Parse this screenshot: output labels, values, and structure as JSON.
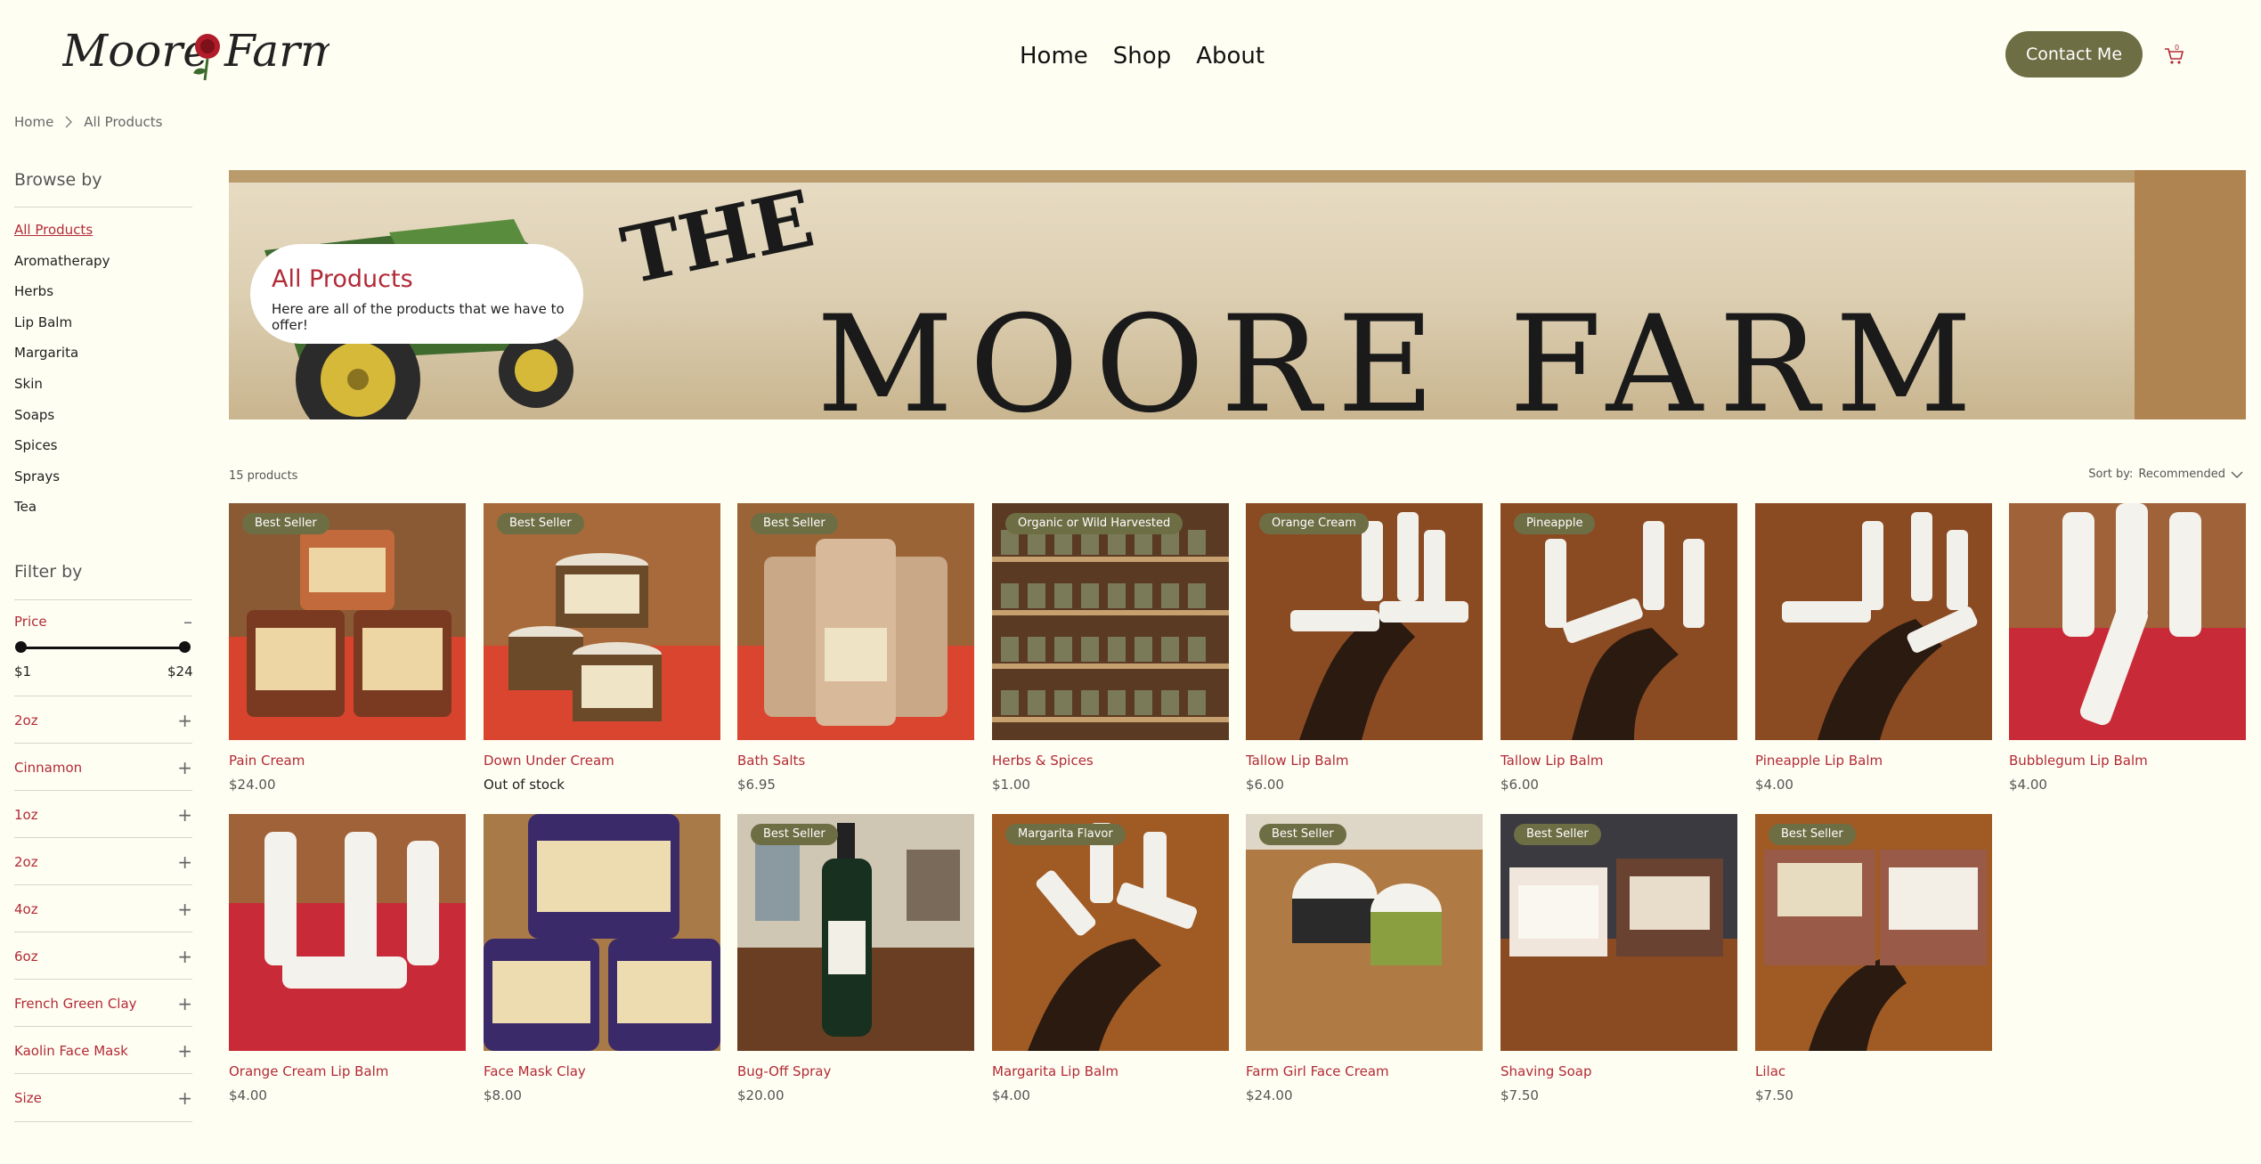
{
  "header": {
    "logo_text_left": "Moore",
    "logo_text_right": "Farm",
    "nav": [
      "Home",
      "Shop",
      "About"
    ],
    "contact_label": "Contact Me",
    "cart_count": "0"
  },
  "breadcrumb": [
    "Home",
    "All Products"
  ],
  "sidebar": {
    "browse_heading": "Browse by",
    "categories": [
      "All Products",
      "Aromatherapy",
      "Herbs",
      "Lip Balm",
      "Margarita",
      "Skin",
      "Soaps",
      "Spices",
      "Sprays",
      "Tea"
    ],
    "active_category": "All Products",
    "filter_heading": "Filter by",
    "price_label": "Price",
    "price_min": "$1",
    "price_max": "$24",
    "filters": [
      "2oz",
      "Cinnamon",
      "1oz",
      "2oz",
      "4oz",
      "6oz",
      "French Green Clay",
      "Kaolin Face Mask",
      "Size"
    ]
  },
  "banner": {
    "title": "All Products",
    "subtitle": "Here are all of the products that we have to offer!",
    "sign_text_1": "THE",
    "sign_text_2": "MOORE FARM"
  },
  "products_meta": {
    "count": "15 products",
    "sort_label": "Sort by:",
    "sort_value": "Recommended"
  },
  "products": [
    {
      "name": "Pain Cream",
      "price": "$24.00",
      "ribbon": "Best Seller"
    },
    {
      "name": "Down Under Cream",
      "price": "Out of stock",
      "ribbon": "Best Seller"
    },
    {
      "name": "Bath Salts",
      "price": "$6.95",
      "ribbon": "Best Seller"
    },
    {
      "name": "Herbs & Spices",
      "price": "$1.00",
      "ribbon": "Organic or Wild Harvested"
    },
    {
      "name": "Tallow Lip Balm",
      "price": "$6.00",
      "ribbon": "Orange Cream"
    },
    {
      "name": "Tallow Lip Balm",
      "price": "$6.00",
      "ribbon": "Pineapple"
    },
    {
      "name": "Pineapple Lip Balm",
      "price": "$4.00",
      "ribbon": ""
    },
    {
      "name": "Bubblegum Lip Balm",
      "price": "$4.00",
      "ribbon": ""
    },
    {
      "name": "Orange Cream Lip Balm",
      "price": "$4.00",
      "ribbon": ""
    },
    {
      "name": "Face Mask Clay",
      "price": "$8.00",
      "ribbon": ""
    },
    {
      "name": "Bug-Off Spray",
      "price": "$20.00",
      "ribbon": "Best Seller"
    },
    {
      "name": "Margarita Lip Balm",
      "price": "$4.00",
      "ribbon": "Margarita Flavor"
    },
    {
      "name": "Farm Girl Face Cream",
      "price": "$24.00",
      "ribbon": "Best Seller"
    },
    {
      "name": "Shaving Soap",
      "price": "$7.50",
      "ribbon": "Best Seller"
    },
    {
      "name": "Lilac",
      "price": "$7.50",
      "ribbon": "Best Seller"
    }
  ],
  "colors": {
    "background": "#fffef3",
    "accent_red": "#b22a36",
    "olive": "#6e6e45"
  }
}
